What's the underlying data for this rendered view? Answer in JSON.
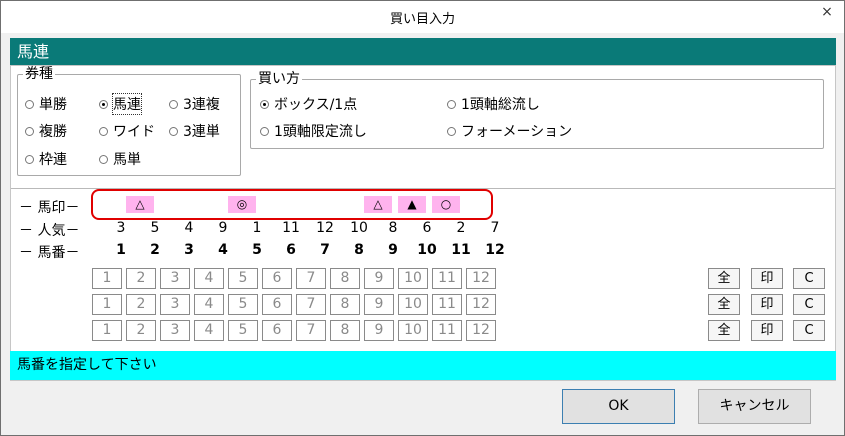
{
  "window": {
    "title": "買い目入力",
    "close_glyph": "×"
  },
  "header": {
    "title": "馬連"
  },
  "ticket_type": {
    "label": "券種",
    "options": [
      {
        "label": "単勝",
        "checked": false
      },
      {
        "label": "馬連",
        "checked": true
      },
      {
        "label": "3連複",
        "checked": false
      },
      {
        "label": "複勝",
        "checked": false
      },
      {
        "label": "ワイド",
        "checked": false
      },
      {
        "label": "3連単",
        "checked": false
      },
      {
        "label": "枠連",
        "checked": false
      },
      {
        "label": "馬単",
        "checked": false
      }
    ]
  },
  "buy_method": {
    "label": "買い方",
    "options": [
      {
        "label": "ボックス/1点",
        "checked": true
      },
      {
        "label": "1頭軸総流し",
        "checked": false
      },
      {
        "label": "1頭軸限定流し",
        "checked": false
      },
      {
        "label": "フォーメーション",
        "checked": false
      }
    ]
  },
  "grid": {
    "mark_label": "－ 馬印－",
    "popularity_label": "－ 人気－",
    "horse_label": "－ 馬番－",
    "marks": [
      "△",
      "",
      "",
      "◎",
      "",
      "",
      "",
      "△",
      "▲",
      "○",
      "",
      ""
    ],
    "popularity": [
      "3",
      "5",
      "4",
      "9",
      "1",
      "11",
      "12",
      "10",
      "8",
      "6",
      "2",
      "7"
    ],
    "horse_numbers": [
      "1",
      "2",
      "3",
      "4",
      "5",
      "6",
      "7",
      "8",
      "9",
      "10",
      "11",
      "12"
    ]
  },
  "side_buttons": {
    "all": "全",
    "mark": "印",
    "clear": "C"
  },
  "status": {
    "message": "馬番を指定して下さい"
  },
  "buttons": {
    "ok": "OK",
    "cancel": "キャンセル"
  },
  "colors": {
    "header": "#0a7a78",
    "status": "#00ffff",
    "mark": "#ffb3ee",
    "highlight": "#e00000"
  }
}
